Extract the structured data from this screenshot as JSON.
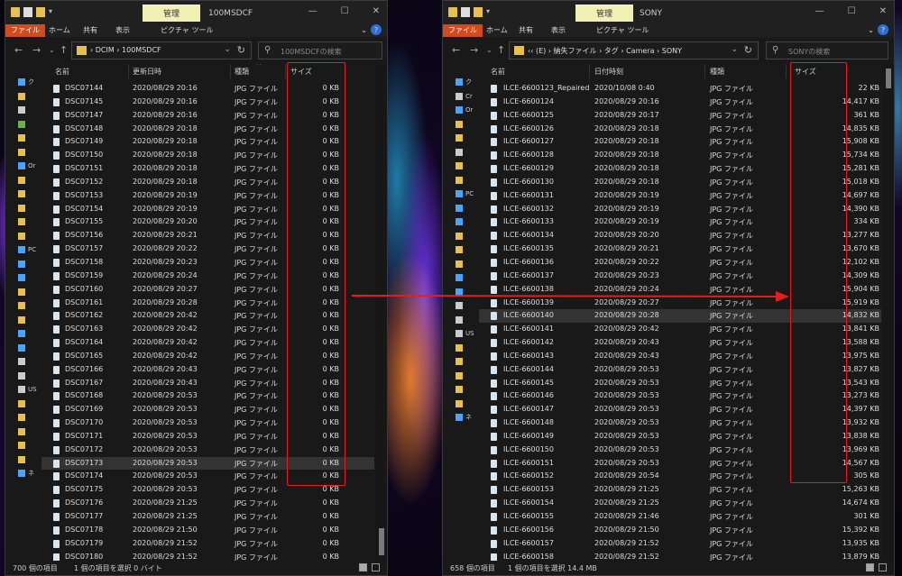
{
  "left_window": {
    "manage_tab": "管理",
    "title": "100MSDCF",
    "ribbon": {
      "file": "ファイル",
      "home": "ホーム",
      "share": "共有",
      "view": "表示",
      "picture_tools": "ピクチャ ツール"
    },
    "breadcrumb": "›  DCIM  ›  100MSDCF",
    "search_placeholder": "100MSDCFの検索",
    "columns": {
      "name": "名前",
      "date": "更新日時",
      "type": "種類",
      "size": "サイズ"
    },
    "nav_items": [
      {
        "label": "ク",
        "color": "#4aa3ff"
      },
      {
        "label": "",
        "color": "#e8c050"
      },
      {
        "label": "",
        "color": "#cccccc"
      },
      {
        "label": "",
        "color": "#6ab04c"
      },
      {
        "label": "",
        "color": "#e8c050"
      },
      {
        "label": "",
        "color": "#e8c050"
      },
      {
        "label": "Or",
        "color": "#4aa3ff"
      },
      {
        "label": "",
        "color": "#e8c050"
      },
      {
        "label": "",
        "color": "#e8c050"
      },
      {
        "label": "",
        "color": "#e8c050"
      },
      {
        "label": "",
        "color": "#e8c050"
      },
      {
        "label": "",
        "color": "#e8c050"
      },
      {
        "label": "PC",
        "color": "#4aa3ff"
      },
      {
        "label": "",
        "color": "#4aa3ff"
      },
      {
        "label": "",
        "color": "#4aa3ff"
      },
      {
        "label": "",
        "color": "#e8c050"
      },
      {
        "label": "",
        "color": "#e8c050"
      },
      {
        "label": "",
        "color": "#e8c050"
      },
      {
        "label": "",
        "color": "#4aa3ff"
      },
      {
        "label": "",
        "color": "#4aa3ff"
      },
      {
        "label": "",
        "color": "#cccccc"
      },
      {
        "label": "",
        "color": "#cccccc"
      },
      {
        "label": "US",
        "color": "#cccccc"
      },
      {
        "label": "",
        "color": "#e8c050"
      },
      {
        "label": "",
        "color": "#e8c050"
      },
      {
        "label": "",
        "color": "#e8c050"
      },
      {
        "label": "",
        "color": "#e8c050"
      },
      {
        "label": "",
        "color": "#e8c050"
      },
      {
        "label": "ネ",
        "color": "#4aa3ff"
      }
    ],
    "rows": [
      {
        "name": "DSC07144",
        "date": "2020/08/29 20:16",
        "type": "JPG ファイル",
        "size": "0 KB"
      },
      {
        "name": "DSC07145",
        "date": "2020/08/29 20:16",
        "type": "JPG ファイル",
        "size": "0 KB"
      },
      {
        "name": "DSC07147",
        "date": "2020/08/29 20:16",
        "type": "JPG ファイル",
        "size": "0 KB"
      },
      {
        "name": "DSC07148",
        "date": "2020/08/29 20:18",
        "type": "JPG ファイル",
        "size": "0 KB"
      },
      {
        "name": "DSC07149",
        "date": "2020/08/29 20:18",
        "type": "JPG ファイル",
        "size": "0 KB"
      },
      {
        "name": "DSC07150",
        "date": "2020/08/29 20:18",
        "type": "JPG ファイル",
        "size": "0 KB"
      },
      {
        "name": "DSC07151",
        "date": "2020/08/29 20:18",
        "type": "JPG ファイル",
        "size": "0 KB"
      },
      {
        "name": "DSC07152",
        "date": "2020/08/29 20:18",
        "type": "JPG ファイル",
        "size": "0 KB"
      },
      {
        "name": "DSC07153",
        "date": "2020/08/29 20:19",
        "type": "JPG ファイル",
        "size": "0 KB"
      },
      {
        "name": "DSC07154",
        "date": "2020/08/29 20:19",
        "type": "JPG ファイル",
        "size": "0 KB"
      },
      {
        "name": "DSC07155",
        "date": "2020/08/29 20:20",
        "type": "JPG ファイル",
        "size": "0 KB"
      },
      {
        "name": "DSC07156",
        "date": "2020/08/29 20:21",
        "type": "JPG ファイル",
        "size": "0 KB"
      },
      {
        "name": "DSC07157",
        "date": "2020/08/29 20:22",
        "type": "JPG ファイル",
        "size": "0 KB"
      },
      {
        "name": "DSC07158",
        "date": "2020/08/29 20:23",
        "type": "JPG ファイル",
        "size": "0 KB"
      },
      {
        "name": "DSC07159",
        "date": "2020/08/29 20:24",
        "type": "JPG ファイル",
        "size": "0 KB"
      },
      {
        "name": "DSC07160",
        "date": "2020/08/29 20:27",
        "type": "JPG ファイル",
        "size": "0 KB"
      },
      {
        "name": "DSC07161",
        "date": "2020/08/29 20:28",
        "type": "JPG ファイル",
        "size": "0 KB"
      },
      {
        "name": "DSC07162",
        "date": "2020/08/29 20:42",
        "type": "JPG ファイル",
        "size": "0 KB"
      },
      {
        "name": "DSC07163",
        "date": "2020/08/29 20:42",
        "type": "JPG ファイル",
        "size": "0 KB"
      },
      {
        "name": "DSC07164",
        "date": "2020/08/29 20:42",
        "type": "JPG ファイル",
        "size": "0 KB"
      },
      {
        "name": "DSC07165",
        "date": "2020/08/29 20:42",
        "type": "JPG ファイル",
        "size": "0 KB"
      },
      {
        "name": "DSC07166",
        "date": "2020/08/29 20:43",
        "type": "JPG ファイル",
        "size": "0 KB"
      },
      {
        "name": "DSC07167",
        "date": "2020/08/29 20:43",
        "type": "JPG ファイル",
        "size": "0 KB"
      },
      {
        "name": "DSC07168",
        "date": "2020/08/29 20:53",
        "type": "JPG ファイル",
        "size": "0 KB"
      },
      {
        "name": "DSC07169",
        "date": "2020/08/29 20:53",
        "type": "JPG ファイル",
        "size": "0 KB"
      },
      {
        "name": "DSC07170",
        "date": "2020/08/29 20:53",
        "type": "JPG ファイル",
        "size": "0 KB"
      },
      {
        "name": "DSC07171",
        "date": "2020/08/29 20:53",
        "type": "JPG ファイル",
        "size": "0 KB"
      },
      {
        "name": "DSC07172",
        "date": "2020/08/29 20:53",
        "type": "JPG ファイル",
        "size": "0 KB"
      },
      {
        "name": "DSC07173",
        "date": "2020/08/29 20:53",
        "type": "JPG ファイル",
        "size": "0 KB",
        "selected": true
      },
      {
        "name": "DSC07174",
        "date": "2020/08/29 20:53",
        "type": "JPG ファイル",
        "size": "0 KB"
      },
      {
        "name": "DSC07175",
        "date": "2020/08/29 20:53",
        "type": "JPG ファイル",
        "size": "0 KB"
      },
      {
        "name": "DSC07176",
        "date": "2020/08/29 21:25",
        "type": "JPG ファイル",
        "size": "0 KB"
      },
      {
        "name": "DSC07177",
        "date": "2020/08/29 21:25",
        "type": "JPG ファイル",
        "size": "0 KB"
      },
      {
        "name": "DSC07178",
        "date": "2020/08/29 21:50",
        "type": "JPG ファイル",
        "size": "0 KB"
      },
      {
        "name": "DSC07179",
        "date": "2020/08/29 21:52",
        "type": "JPG ファイル",
        "size": "0 KB"
      },
      {
        "name": "DSC07180",
        "date": "2020/08/29 21:52",
        "type": "JPG ファイル",
        "size": "0 KB"
      }
    ],
    "status": {
      "count": "700 個の項目",
      "selection": "1 個の項目を選択  0 バイト"
    }
  },
  "right_window": {
    "manage_tab": "管理",
    "title": "SONY",
    "ribbon": {
      "file": "ファイル",
      "home": "ホーム",
      "share": "共有",
      "view": "表示",
      "picture_tools": "ピクチャ ツール"
    },
    "breadcrumb": "‹‹  (E)  ›  納失ファイル  ›  タグ  ›  Camera  ›  SONY",
    "search_placeholder": "SONYの検索",
    "columns": {
      "name": "名前",
      "date": "日付時刻",
      "type": "種類",
      "size": "サイズ"
    },
    "nav_items": [
      {
        "label": "ク",
        "color": "#4aa3ff"
      },
      {
        "label": "Cr",
        "color": "#cccccc"
      },
      {
        "label": "Or",
        "color": "#4aa3ff"
      },
      {
        "label": "",
        "color": "#e8c050"
      },
      {
        "label": "",
        "color": "#e8c050"
      },
      {
        "label": "",
        "color": "#cccccc"
      },
      {
        "label": "",
        "color": "#e8c050"
      },
      {
        "label": "",
        "color": "#e8c050"
      },
      {
        "label": "PC",
        "color": "#4aa3ff"
      },
      {
        "label": "",
        "color": "#4aa3ff"
      },
      {
        "label": "",
        "color": "#4aa3ff"
      },
      {
        "label": "",
        "color": "#e8c050"
      },
      {
        "label": "",
        "color": "#e8c050"
      },
      {
        "label": "",
        "color": "#e8c050"
      },
      {
        "label": "",
        "color": "#4aa3ff"
      },
      {
        "label": "",
        "color": "#4aa3ff"
      },
      {
        "label": "",
        "color": "#cccccc"
      },
      {
        "label": "",
        "color": "#cccccc"
      },
      {
        "label": "US",
        "color": "#cccccc"
      },
      {
        "label": "",
        "color": "#e8c050"
      },
      {
        "label": "",
        "color": "#e8c050"
      },
      {
        "label": "",
        "color": "#e8c050"
      },
      {
        "label": "",
        "color": "#e8c050"
      },
      {
        "label": "",
        "color": "#e8c050"
      },
      {
        "label": "ネ",
        "color": "#4aa3ff"
      }
    ],
    "rows": [
      {
        "name": "ILCE-6600123_Repaired",
        "date": "2020/10/08 0:40",
        "type": "JPG ファイル",
        "size": "22 KB"
      },
      {
        "name": "ILCE-6600124",
        "date": "2020/08/29 20:16",
        "type": "JPG ファイル",
        "size": "14,417 KB"
      },
      {
        "name": "ILCE-6600125",
        "date": "2020/08/29 20:17",
        "type": "JPG ファイル",
        "size": "361 KB"
      },
      {
        "name": "ILCE-6600126",
        "date": "2020/08/29 20:18",
        "type": "JPG ファイル",
        "size": "14,835 KB"
      },
      {
        "name": "ILCE-6600127",
        "date": "2020/08/29 20:18",
        "type": "JPG ファイル",
        "size": "15,908 KB"
      },
      {
        "name": "ILCE-6600128",
        "date": "2020/08/29 20:18",
        "type": "JPG ファイル",
        "size": "15,734 KB"
      },
      {
        "name": "ILCE-6600129",
        "date": "2020/08/29 20:18",
        "type": "JPG ファイル",
        "size": "15,281 KB"
      },
      {
        "name": "ILCE-6600130",
        "date": "2020/08/29 20:18",
        "type": "JPG ファイル",
        "size": "15,018 KB"
      },
      {
        "name": "ILCE-6600131",
        "date": "2020/08/29 20:19",
        "type": "JPG ファイル",
        "size": "14,697 KB"
      },
      {
        "name": "ILCE-6600132",
        "date": "2020/08/29 20:19",
        "type": "JPG ファイル",
        "size": "14,390 KB"
      },
      {
        "name": "ILCE-6600133",
        "date": "2020/08/29 20:19",
        "type": "JPG ファイル",
        "size": "334 KB"
      },
      {
        "name": "ILCE-6600134",
        "date": "2020/08/29 20:20",
        "type": "JPG ファイル",
        "size": "13,277 KB"
      },
      {
        "name": "ILCE-6600135",
        "date": "2020/08/29 20:21",
        "type": "JPG ファイル",
        "size": "13,670 KB"
      },
      {
        "name": "ILCE-6600136",
        "date": "2020/08/29 20:22",
        "type": "JPG ファイル",
        "size": "12,102 KB"
      },
      {
        "name": "ILCE-6600137",
        "date": "2020/08/29 20:23",
        "type": "JPG ファイル",
        "size": "14,309 KB"
      },
      {
        "name": "ILCE-6600138",
        "date": "2020/08/29 20:24",
        "type": "JPG ファイル",
        "size": "15,904 KB"
      },
      {
        "name": "ILCE-6600139",
        "date": "2020/08/29 20:27",
        "type": "JPG ファイル",
        "size": "15,919 KB"
      },
      {
        "name": "ILCE-6600140",
        "date": "2020/08/29 20:28",
        "type": "JPG ファイル",
        "size": "14,832 KB",
        "selected": true
      },
      {
        "name": "ILCE-6600141",
        "date": "2020/08/29 20:42",
        "type": "JPG ファイル",
        "size": "13,841 KB"
      },
      {
        "name": "ILCE-6600142",
        "date": "2020/08/29 20:43",
        "type": "JPG ファイル",
        "size": "13,588 KB"
      },
      {
        "name": "ILCE-6600143",
        "date": "2020/08/29 20:43",
        "type": "JPG ファイル",
        "size": "13,975 KB"
      },
      {
        "name": "ILCE-6600144",
        "date": "2020/08/29 20:53",
        "type": "JPG ファイル",
        "size": "13,827 KB"
      },
      {
        "name": "ILCE-6600145",
        "date": "2020/08/29 20:53",
        "type": "JPG ファイル",
        "size": "13,543 KB"
      },
      {
        "name": "ILCE-6600146",
        "date": "2020/08/29 20:53",
        "type": "JPG ファイル",
        "size": "13,273 KB"
      },
      {
        "name": "ILCE-6600147",
        "date": "2020/08/29 20:53",
        "type": "JPG ファイル",
        "size": "14,397 KB"
      },
      {
        "name": "ILCE-6600148",
        "date": "2020/08/29 20:53",
        "type": "JPG ファイル",
        "size": "13,932 KB"
      },
      {
        "name": "ILCE-6600149",
        "date": "2020/08/29 20:53",
        "type": "JPG ファイル",
        "size": "13,838 KB"
      },
      {
        "name": "ILCE-6600150",
        "date": "2020/08/29 20:53",
        "type": "JPG ファイル",
        "size": "13,969 KB"
      },
      {
        "name": "ILCE-6600151",
        "date": "2020/08/29 20:53",
        "type": "JPG ファイル",
        "size": "14,567 KB"
      },
      {
        "name": "ILCE-6600152",
        "date": "2020/08/29 20:54",
        "type": "JPG ファイル",
        "size": "305 KB"
      },
      {
        "name": "ILCE-6600153",
        "date": "2020/08/29 21:25",
        "type": "JPG ファイル",
        "size": "15,263 KB"
      },
      {
        "name": "ILCE-6600154",
        "date": "2020/08/29 21:25",
        "type": "JPG ファイル",
        "size": "14,674 KB"
      },
      {
        "name": "ILCE-6600155",
        "date": "2020/08/29 21:46",
        "type": "JPG ファイル",
        "size": "301 KB"
      },
      {
        "name": "ILCE-6600156",
        "date": "2020/08/29 21:50",
        "type": "JPG ファイル",
        "size": "15,392 KB"
      },
      {
        "name": "ILCE-6600157",
        "date": "2020/08/29 21:52",
        "type": "JPG ファイル",
        "size": "13,935 KB"
      },
      {
        "name": "ILCE-6600158",
        "date": "2020/08/29 21:52",
        "type": "JPG ファイル",
        "size": "13,879 KB"
      }
    ],
    "status": {
      "count": "658 個の項目",
      "selection": "1 個の項目を選択  14.4 MB"
    }
  },
  "colors": {
    "highlight": "#e02020",
    "file_tab": "#d04c1e",
    "manage_tab": "#f3f0b5",
    "window_bg": "#191919",
    "folder": "#e8c050"
  }
}
